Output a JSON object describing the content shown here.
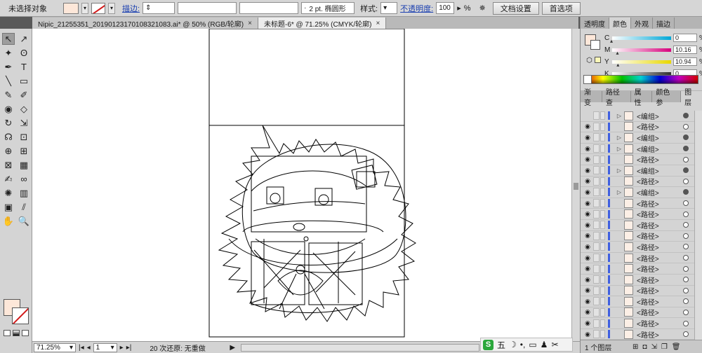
{
  "control_bar": {
    "selection_status": "未选择对象",
    "stroke_label": "描边:",
    "stroke_profile": "2 pt. 椭圆形",
    "style_label": "样式:",
    "opacity_label": "不透明度:",
    "opacity_value": "100",
    "opacity_unit": "%",
    "doc_setup_button": "文档设置",
    "preferences_button": "首选项",
    "fill_color": "#fde7d9"
  },
  "doc_tabs": [
    {
      "label": "Nipic_21255351_20190123170108321083.ai* @ 50% (RGB/轮廓)",
      "close": "×"
    },
    {
      "label": "未标题-6* @ 71.25% (CMYK/轮廓)",
      "close": "×"
    }
  ],
  "tools": [
    "selection-tool",
    "direct-selection-tool",
    "magic-wand-tool",
    "lasso-tool",
    "pen-tool",
    "type-tool",
    "line-tool",
    "rectangle-tool",
    "paintbrush-tool",
    "pencil-tool",
    "blob-brush-tool",
    "eraser-tool",
    "rotate-tool",
    "scale-tool",
    "warp-tool",
    "free-transform-tool",
    "shape-builder-tool",
    "perspective-grid-tool",
    "mesh-tool",
    "gradient-tool",
    "eyedropper-tool",
    "blend-tool",
    "symbol-sprayer-tool",
    "column-graph-tool",
    "artboard-tool",
    "slice-tool",
    "hand-tool",
    "zoom-tool"
  ],
  "tool_glyphs": [
    "↖",
    "↗",
    "✦",
    "ʘ",
    "✒",
    "T",
    "╲",
    "▭",
    "✎",
    "✐",
    "◉",
    "◇",
    "↻",
    "⇲",
    "☊",
    "⊡",
    "⊕",
    "⊞",
    "⊠",
    "▦",
    "✍",
    "∞",
    "✺",
    "▥",
    "▣",
    "⫽",
    "✋",
    "🔍"
  ],
  "status": {
    "zoom": "71.25%",
    "page": "1",
    "undo_status": "20 次还原: 无重做"
  },
  "panels": {
    "color_tabs": [
      "透明度",
      "颜色",
      "外观",
      "描边"
    ],
    "active_color_tab": "颜色",
    "cmyk": [
      {
        "label": "C",
        "value": "0",
        "pct": 0.0,
        "color": "#00a8d8"
      },
      {
        "label": "M",
        "value": "10.16",
        "pct": 0.1016,
        "color": "#d8007c"
      },
      {
        "label": "Y",
        "value": "10.94",
        "pct": 0.1094,
        "color": "#e8d800"
      },
      {
        "label": "K",
        "value": "0",
        "pct": 0.0,
        "color": "#303030"
      }
    ],
    "layer_tabs": [
      "渐变",
      "路径查",
      "属性",
      "颜色参",
      "图层"
    ],
    "active_layer_tab": "图层",
    "layers": [
      {
        "name": "<编组>",
        "expand": "▷",
        "target": "full"
      },
      {
        "name": "<路径>",
        "expand": "",
        "target": "empty"
      },
      {
        "name": "<编组>",
        "expand": "▷",
        "target": "full"
      },
      {
        "name": "<编组>",
        "expand": "▷",
        "target": "full"
      },
      {
        "name": "<路径>",
        "expand": "",
        "target": "empty"
      },
      {
        "name": "<编组>",
        "expand": "▷",
        "target": "full"
      },
      {
        "name": "<路径>",
        "expand": "",
        "target": "empty"
      },
      {
        "name": "<编组>",
        "expand": "▷",
        "target": "full"
      },
      {
        "name": "<路径>",
        "expand": "",
        "target": "empty"
      },
      {
        "name": "<路径>",
        "expand": "",
        "target": "empty"
      },
      {
        "name": "<路径>",
        "expand": "",
        "target": "empty"
      },
      {
        "name": "<路径>",
        "expand": "",
        "target": "empty"
      },
      {
        "name": "<路径>",
        "expand": "",
        "target": "empty"
      },
      {
        "name": "<路径>",
        "expand": "",
        "target": "empty"
      },
      {
        "name": "<路径>",
        "expand": "",
        "target": "empty"
      },
      {
        "name": "<路径>",
        "expand": "",
        "target": "empty"
      },
      {
        "name": "<路径>",
        "expand": "",
        "target": "empty"
      },
      {
        "name": "<路径>",
        "expand": "",
        "target": "empty"
      },
      {
        "name": "<路径>",
        "expand": "",
        "target": "empty"
      },
      {
        "name": "<路径>",
        "expand": "",
        "target": "empty"
      },
      {
        "name": "<路径>",
        "expand": "",
        "target": "empty"
      },
      {
        "name": "<路径>",
        "expand": "",
        "target": "empty"
      }
    ],
    "layer_count": "1 个图层"
  },
  "ime": {
    "logo": "S",
    "mode": "五"
  }
}
